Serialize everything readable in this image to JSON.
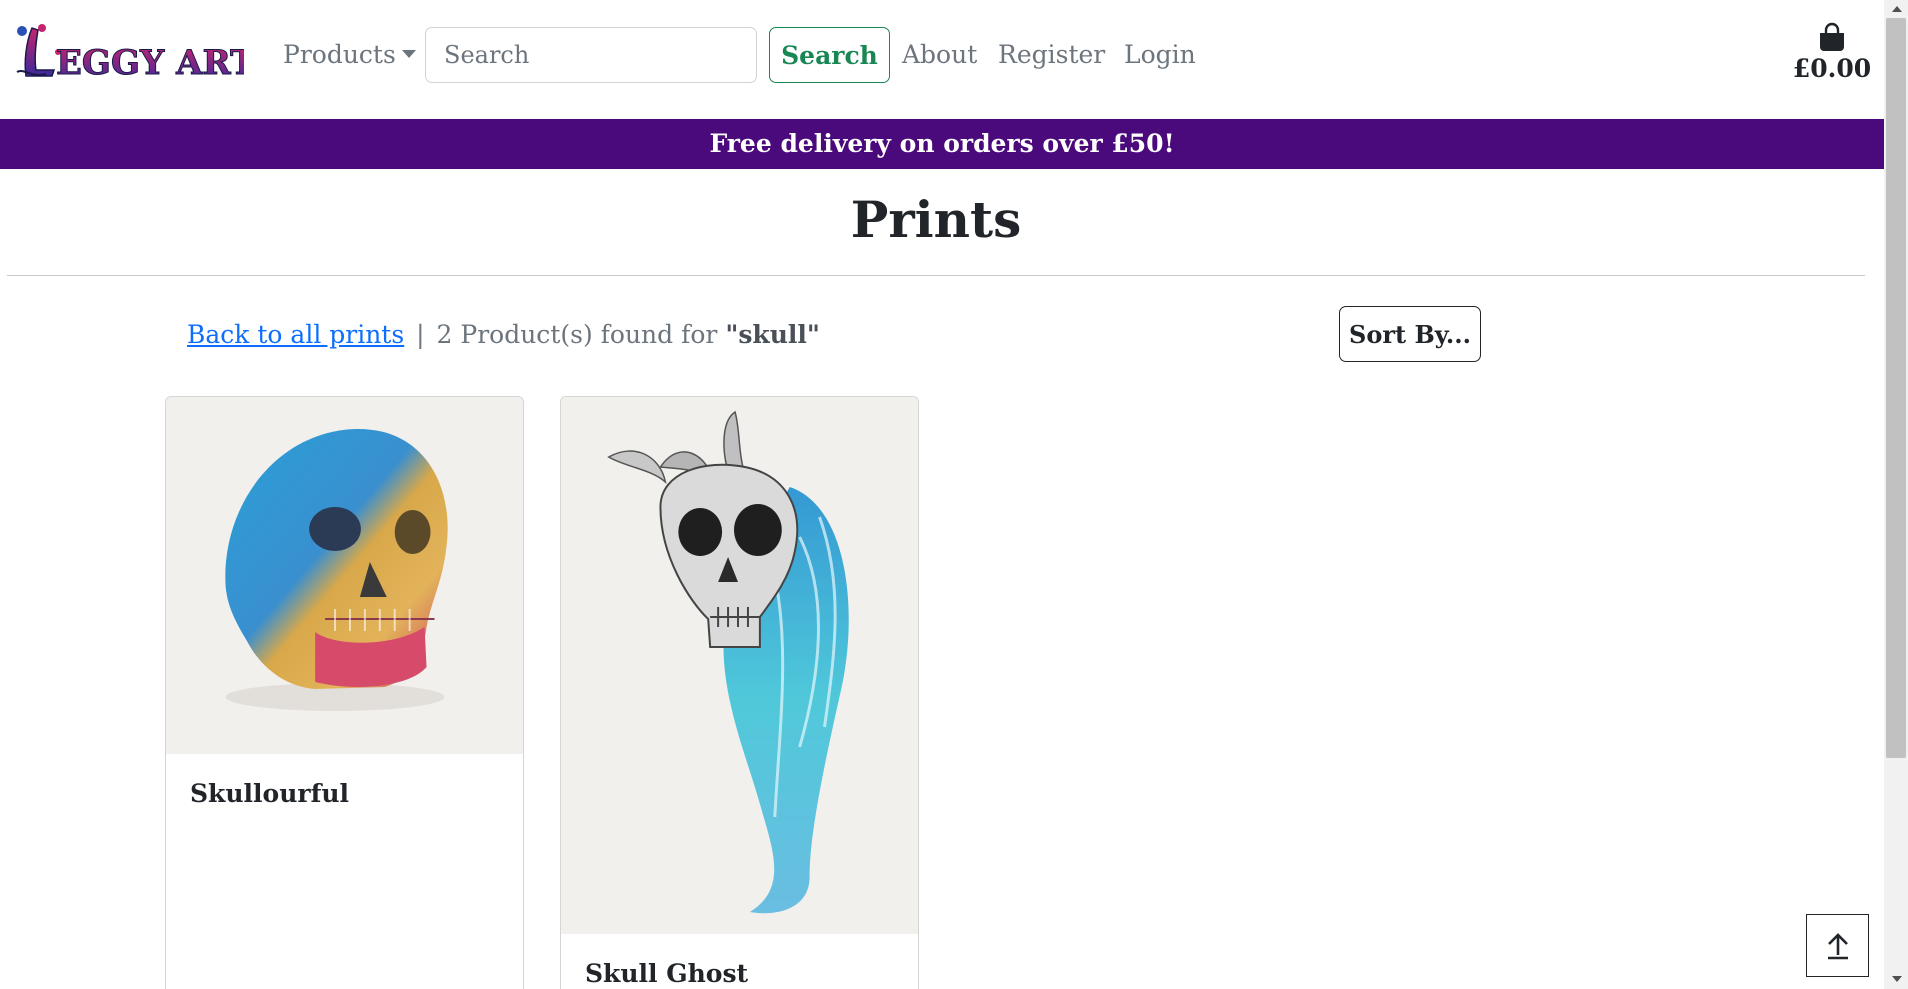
{
  "header": {
    "logo_text": "Leggy Art",
    "nav": {
      "products_label": "Products",
      "about_label": "About",
      "register_label": "Register",
      "login_label": "Login"
    },
    "search": {
      "placeholder": "Search",
      "value": "",
      "button_label": "Search"
    },
    "cart": {
      "icon": "shopping-bag-icon",
      "total": "£0.00"
    }
  },
  "banner": {
    "text": "Free delivery on orders over £50!",
    "background": "#4b0a7c"
  },
  "page": {
    "title": "Prints"
  },
  "results": {
    "back_link_label": "Back to all prints",
    "separator": "|",
    "count_text": "2 Product(s) found for",
    "search_term": "\"skull\"",
    "sort_label": "Sort By..."
  },
  "products": [
    {
      "name": "Skullourful",
      "image": "multicoloured skull drawing"
    },
    {
      "name": "Skull Ghost",
      "image": "horned skull with blue ghostly tail drawing"
    }
  ],
  "back_to_top": {
    "icon": "arrow-up-icon"
  },
  "colors": {
    "brand_purple": "#4b0a7c",
    "success_green": "#198754",
    "link_blue": "#0d6efd",
    "muted_grey": "#6c757d"
  }
}
